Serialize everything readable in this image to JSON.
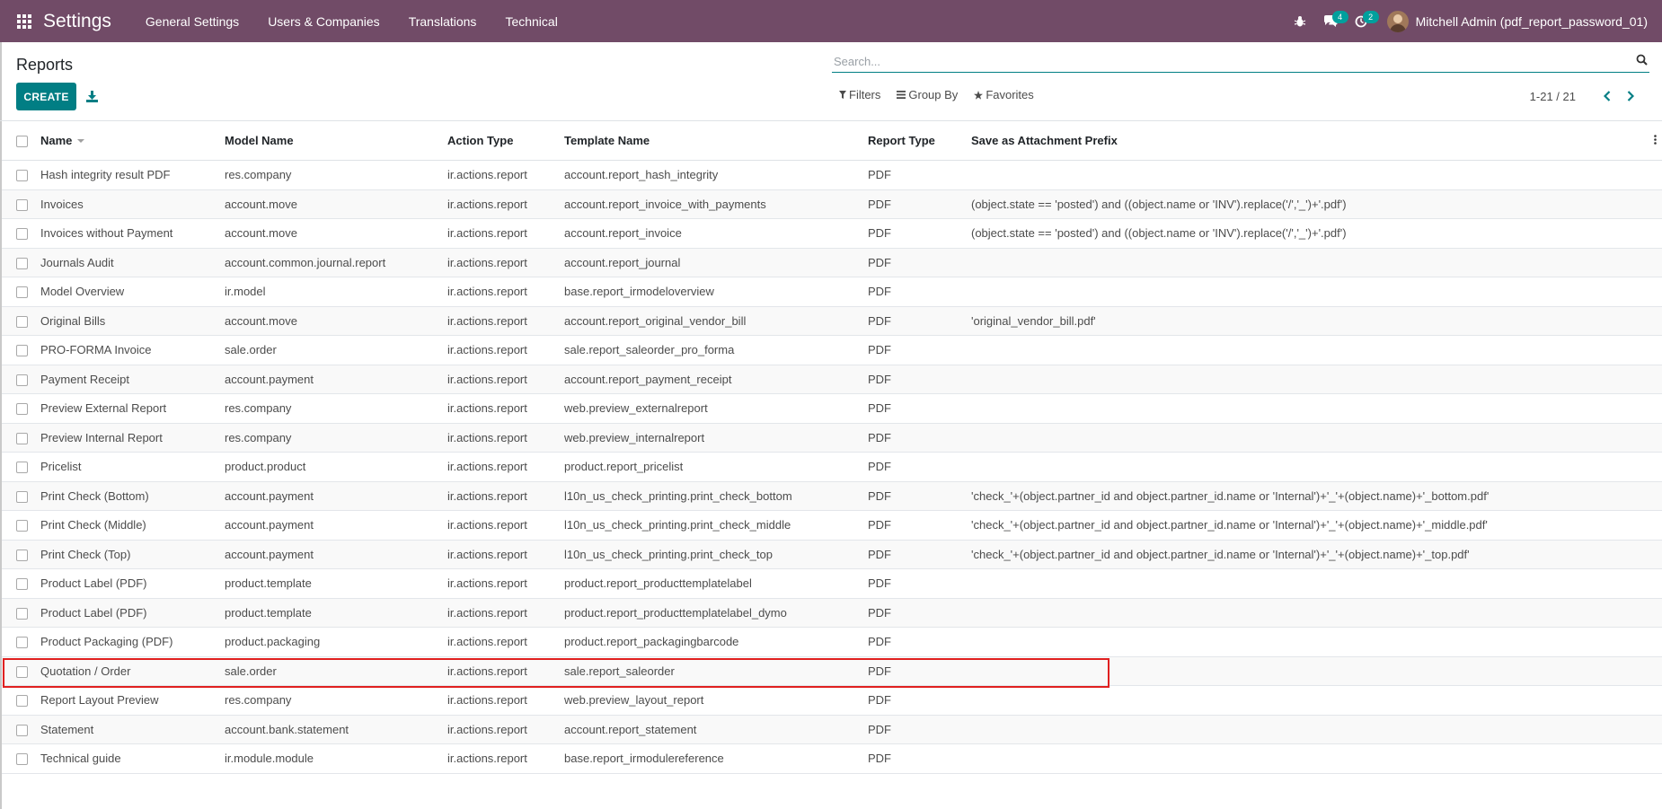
{
  "navbar": {
    "app_title": "Settings",
    "menu": [
      "General Settings",
      "Users & Companies",
      "Translations",
      "Technical"
    ],
    "chat_badge": "4",
    "activity_badge": "2",
    "user_name": "Mitchell Admin (pdf_report_password_01)",
    "bg_color": "#714b67"
  },
  "control": {
    "breadcrumb": "Reports",
    "create_label": "CREATE",
    "search_placeholder": "Search...",
    "filters_label": "Filters",
    "groupby_label": "Group By",
    "favorites_label": "Favorites",
    "pager_value": "1-21 / 21",
    "accent_color": "#017e84"
  },
  "table": {
    "columns": [
      "Name",
      "Model Name",
      "Action Type",
      "Template Name",
      "Report Type",
      "Save as Attachment Prefix"
    ],
    "rows": [
      [
        "Hash integrity result PDF",
        "res.company",
        "ir.actions.report",
        "account.report_hash_integrity",
        "PDF",
        ""
      ],
      [
        "Invoices",
        "account.move",
        "ir.actions.report",
        "account.report_invoice_with_payments",
        "PDF",
        "(object.state == 'posted') and ((object.name or 'INV').replace('/','_')+'.pdf')"
      ],
      [
        "Invoices without Payment",
        "account.move",
        "ir.actions.report",
        "account.report_invoice",
        "PDF",
        "(object.state == 'posted') and ((object.name or 'INV').replace('/','_')+'.pdf')"
      ],
      [
        "Journals Audit",
        "account.common.journal.report",
        "ir.actions.report",
        "account.report_journal",
        "PDF",
        ""
      ],
      [
        "Model Overview",
        "ir.model",
        "ir.actions.report",
        "base.report_irmodeloverview",
        "PDF",
        ""
      ],
      [
        "Original Bills",
        "account.move",
        "ir.actions.report",
        "account.report_original_vendor_bill",
        "PDF",
        "'original_vendor_bill.pdf'"
      ],
      [
        "PRO-FORMA Invoice",
        "sale.order",
        "ir.actions.report",
        "sale.report_saleorder_pro_forma",
        "PDF",
        ""
      ],
      [
        "Payment Receipt",
        "account.payment",
        "ir.actions.report",
        "account.report_payment_receipt",
        "PDF",
        ""
      ],
      [
        "Preview External Report",
        "res.company",
        "ir.actions.report",
        "web.preview_externalreport",
        "PDF",
        ""
      ],
      [
        "Preview Internal Report",
        "res.company",
        "ir.actions.report",
        "web.preview_internalreport",
        "PDF",
        ""
      ],
      [
        "Pricelist",
        "product.product",
        "ir.actions.report",
        "product.report_pricelist",
        "PDF",
        ""
      ],
      [
        "Print Check (Bottom)",
        "account.payment",
        "ir.actions.report",
        "l10n_us_check_printing.print_check_bottom",
        "PDF",
        "'check_'+(object.partner_id and object.partner_id.name or 'Internal')+'_'+(object.name)+'_bottom.pdf'"
      ],
      [
        "Print Check (Middle)",
        "account.payment",
        "ir.actions.report",
        "l10n_us_check_printing.print_check_middle",
        "PDF",
        "'check_'+(object.partner_id and object.partner_id.name or 'Internal')+'_'+(object.name)+'_middle.pdf'"
      ],
      [
        "Print Check (Top)",
        "account.payment",
        "ir.actions.report",
        "l10n_us_check_printing.print_check_top",
        "PDF",
        "'check_'+(object.partner_id and object.partner_id.name or 'Internal')+'_'+(object.name)+'_top.pdf'"
      ],
      [
        "Product Label (PDF)",
        "product.template",
        "ir.actions.report",
        "product.report_producttemplatelabel",
        "PDF",
        ""
      ],
      [
        "Product Label (PDF)",
        "product.template",
        "ir.actions.report",
        "product.report_producttemplatelabel_dymo",
        "PDF",
        ""
      ],
      [
        "Product Packaging (PDF)",
        "product.packaging",
        "ir.actions.report",
        "product.report_packagingbarcode",
        "PDF",
        ""
      ],
      [
        "Quotation / Order",
        "sale.order",
        "ir.actions.report",
        "sale.report_saleorder",
        "PDF",
        ""
      ],
      [
        "Report Layout Preview",
        "res.company",
        "ir.actions.report",
        "web.preview_layout_report",
        "PDF",
        ""
      ],
      [
        "Statement",
        "account.bank.statement",
        "ir.actions.report",
        "account.report_statement",
        "PDF",
        ""
      ],
      [
        "Technical guide",
        "ir.module.module",
        "ir.actions.report",
        "base.report_irmodulereference",
        "PDF",
        ""
      ]
    ],
    "highlighted_row_index": 17,
    "highlight_color": "#e02020"
  }
}
